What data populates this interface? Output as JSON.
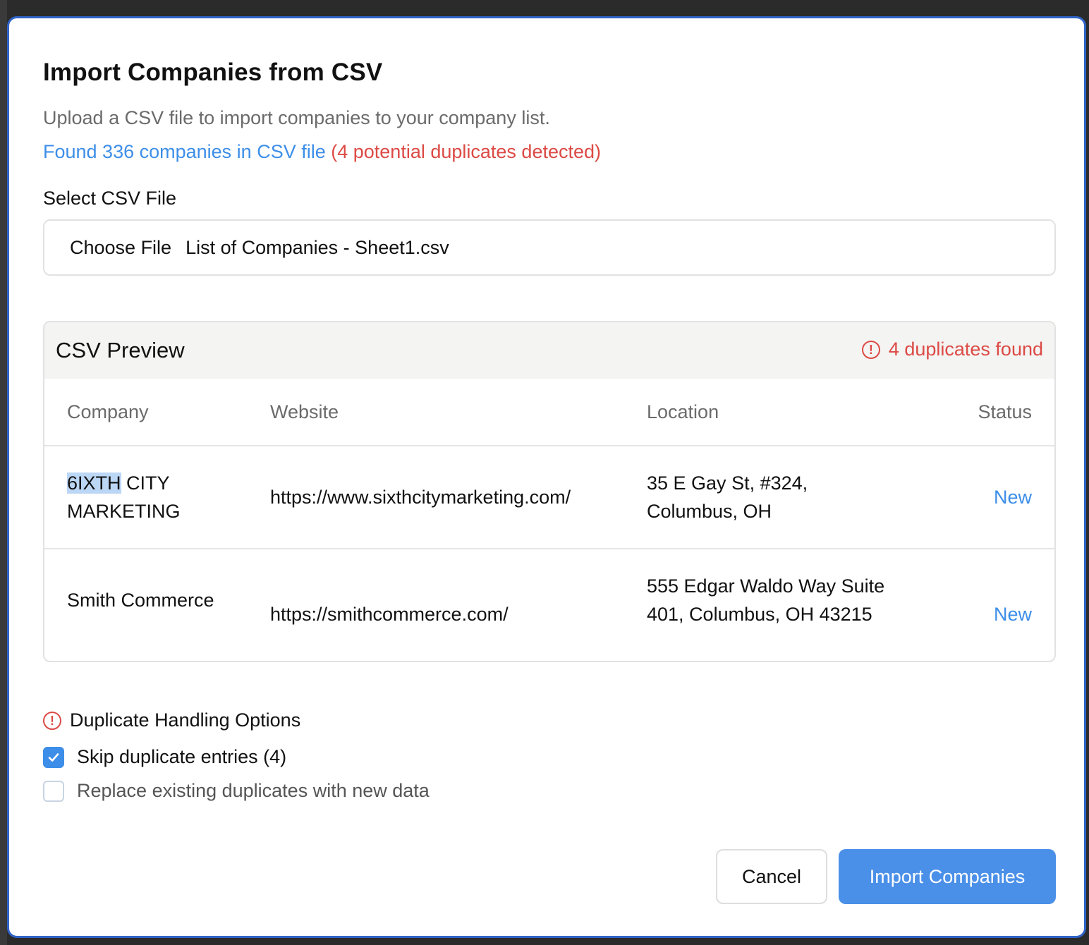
{
  "dialog": {
    "title": "Import Companies from CSV",
    "subtitle": "Upload a CSV file to import companies to your company list.",
    "found_text": "Found 336 companies in CSV file",
    "duplicates_text": "(4 potential duplicates detected)"
  },
  "file_field": {
    "label": "Select CSV File",
    "button_label": "Choose File",
    "file_name": "List of Companies - Sheet1.csv"
  },
  "preview": {
    "title": "CSV Preview",
    "duplicates_badge": "4 duplicates found",
    "columns": [
      "Company",
      "Website",
      "Location",
      "Status"
    ],
    "rows": [
      {
        "company_highlight": "6IXTH",
        "company_rest": " CITY MARKETING",
        "website": "https://www.sixthcitymarketing.com/",
        "location": "35 E Gay St, #324, Columbus, OH",
        "status": "New"
      },
      {
        "company_highlight": "",
        "company_rest": "Smith Commerce",
        "website": "https://smithcommerce.com/",
        "location": "555 Edgar Waldo Way Suite 401, Columbus, OH 43215",
        "status": "New"
      }
    ]
  },
  "duplicate_options": {
    "heading": "Duplicate Handling Options",
    "skip_label": "Skip duplicate entries (4)",
    "skip_checked": true,
    "replace_label": "Replace existing duplicates with new data",
    "replace_checked": false
  },
  "actions": {
    "cancel_label": "Cancel",
    "import_label": "Import Companies"
  },
  "colors": {
    "accent": "#4a90e8",
    "link_blue": "#3d8ee8",
    "danger": "#dc4a45",
    "dialog_border": "#2f63c7"
  },
  "icons": {
    "alert": "alert-circle-icon",
    "check": "checkmark-icon"
  }
}
